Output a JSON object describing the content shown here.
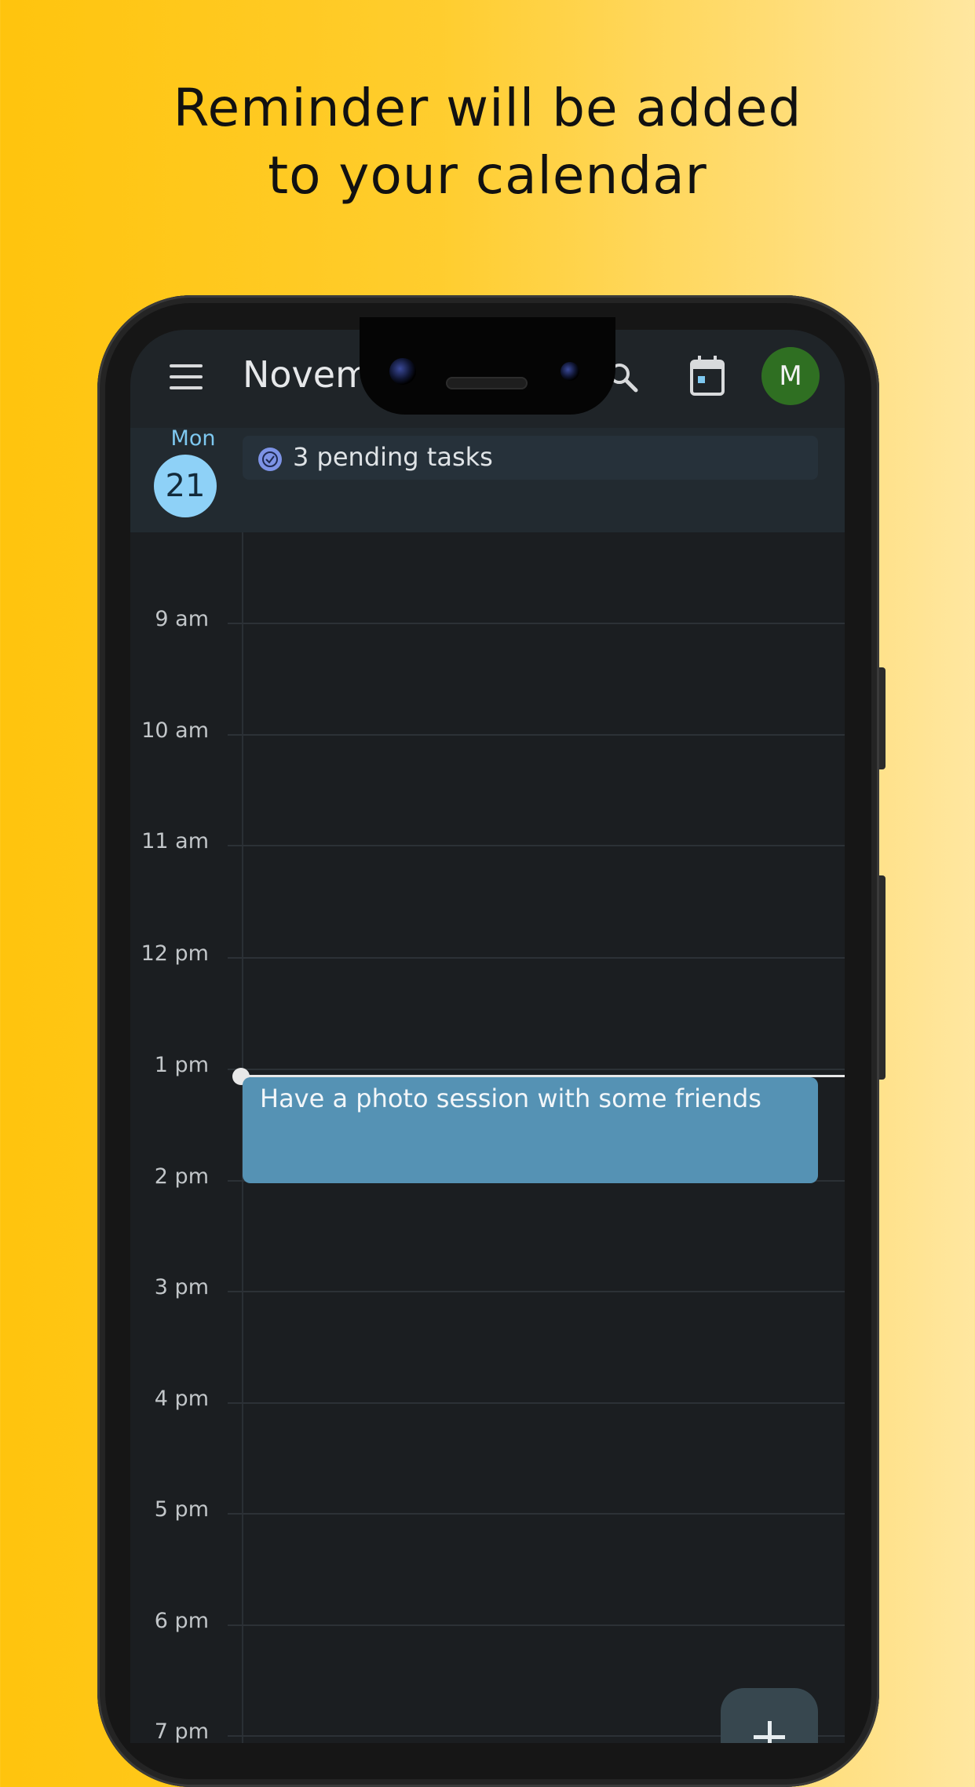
{
  "promo": {
    "headline_line1": "Reminder will be added",
    "headline_line2": "to your calendar"
  },
  "app_bar": {
    "month_title": "Novem",
    "avatar_initial": "M",
    "avatar_color": "#2f6f22"
  },
  "day": {
    "name": "Mon",
    "number": "21"
  },
  "tasks_chip": {
    "label": "3 pending tasks"
  },
  "hours": [
    "9 am",
    "10 am",
    "11 am",
    "12 pm",
    "1 pm",
    "2 pm",
    "3 pm",
    "4 pm",
    "5 pm",
    "6 pm",
    "7 pm"
  ],
  "event": {
    "title": "Have a photo session with some friends",
    "color": "#5592b4"
  },
  "colors": {
    "accent_today": "#8ed1f7",
    "background": "#1b1e21"
  }
}
